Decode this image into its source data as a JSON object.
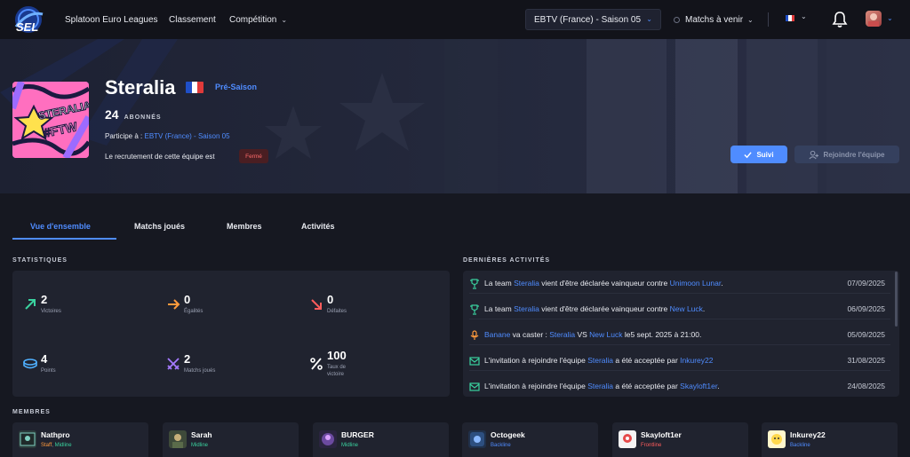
{
  "nav": {
    "logo_text": "SEL",
    "links": [
      "Splatoon Euro Leagues",
      "Classement",
      "Compétition"
    ],
    "season_select": "EBTV (France) - Saison 05",
    "matches_label": "Matchs à venir"
  },
  "team": {
    "name": "Steralia",
    "logo_text": "STERALIA #FTW",
    "status": "Pré-Saison",
    "subscribers": "24",
    "subscribers_label": "ABONNÉS",
    "participates_label": "Participe à :",
    "participates_value": "EBTV (France) - Saison 05",
    "recruit_label": "Le recrutement de cette équipe est",
    "recruit_status": "Fermé",
    "follow_button": "Suivi",
    "join_button": "Rejoindre l'équipe"
  },
  "tabs": [
    "Vue d'ensemble",
    "Matchs joués",
    "Membres",
    "Activités"
  ],
  "stats": {
    "title": "STATISTIQUES",
    "items": [
      {
        "value": "2",
        "label": "Victoires"
      },
      {
        "value": "0",
        "label": "Égalités"
      },
      {
        "value": "0",
        "label": "Défaites"
      },
      {
        "value": "4",
        "label": "Points"
      },
      {
        "value": "2",
        "label": "Matchs joués"
      },
      {
        "value": "100",
        "label1": "Taux de",
        "label2": "victoire"
      }
    ]
  },
  "activities": {
    "title": "DERNIÈRES ACTIVITÉS",
    "items": [
      {
        "type": "trophy",
        "parts": [
          "La team ",
          "Steralia",
          " vient d'être déclarée vainqueur contre ",
          "Unimoon Lunar",
          "."
        ],
        "date": "07/09/2025"
      },
      {
        "type": "trophy",
        "parts": [
          "La team ",
          "Steralia",
          " vient d'être déclarée vainqueur contre ",
          "New Luck",
          "."
        ],
        "date": "06/09/2025"
      },
      {
        "type": "mic",
        "parts": [
          "",
          "Banane",
          " va caster : ",
          "Steralia",
          " VS ",
          "New Luck",
          " le5 sept. 2025 à 21:00."
        ],
        "date": "05/09/2025"
      },
      {
        "type": "mail",
        "parts": [
          "L'invitation à rejoindre l'équipe ",
          "Steralia",
          " a été acceptée par ",
          "Inkurey22",
          ""
        ],
        "date": "31/08/2025"
      },
      {
        "type": "mail",
        "parts": [
          "L'invitation à rejoindre l'équipe ",
          "Steralia",
          " a été acceptée par ",
          "Skayloft1er",
          "."
        ],
        "date": "24/08/2025"
      }
    ]
  },
  "members": {
    "title": "MEMBRES",
    "items": [
      {
        "name": "Nathpro",
        "role_a": "Staff",
        "role_b": "Midline"
      },
      {
        "name": "Sarah",
        "role_a": "",
        "role_b": "Midline"
      },
      {
        "name": "BURGER",
        "role_a": "",
        "role_b": "Midline"
      },
      {
        "name": "Octogeek",
        "role_a": "",
        "role_b": "Backline"
      },
      {
        "name": "Skayloft1er",
        "role_a": "",
        "role_b": "Frontline"
      },
      {
        "name": "Inkurey22",
        "role_a": "",
        "role_b": "Backline"
      }
    ]
  },
  "colors": {
    "accent": "#4f8cff",
    "background": "#161821",
    "card": "#20232f",
    "win": "#3ad29f",
    "draw": "#ff9a3c",
    "loss": "#ff5c5c",
    "closed": "#ff6b6b",
    "staff": "#ff9a3c",
    "midline": "#3ad29f",
    "backline": "#4f8cff",
    "frontline": "#ff5c5c"
  },
  "icons": {
    "victoires": "arrow-up-right-icon",
    "egalites": "arrow-right-icon",
    "defaites": "arrow-down-right-icon",
    "points": "disc-icon",
    "matchs": "swords-icon",
    "taux": "percent-icon"
  }
}
